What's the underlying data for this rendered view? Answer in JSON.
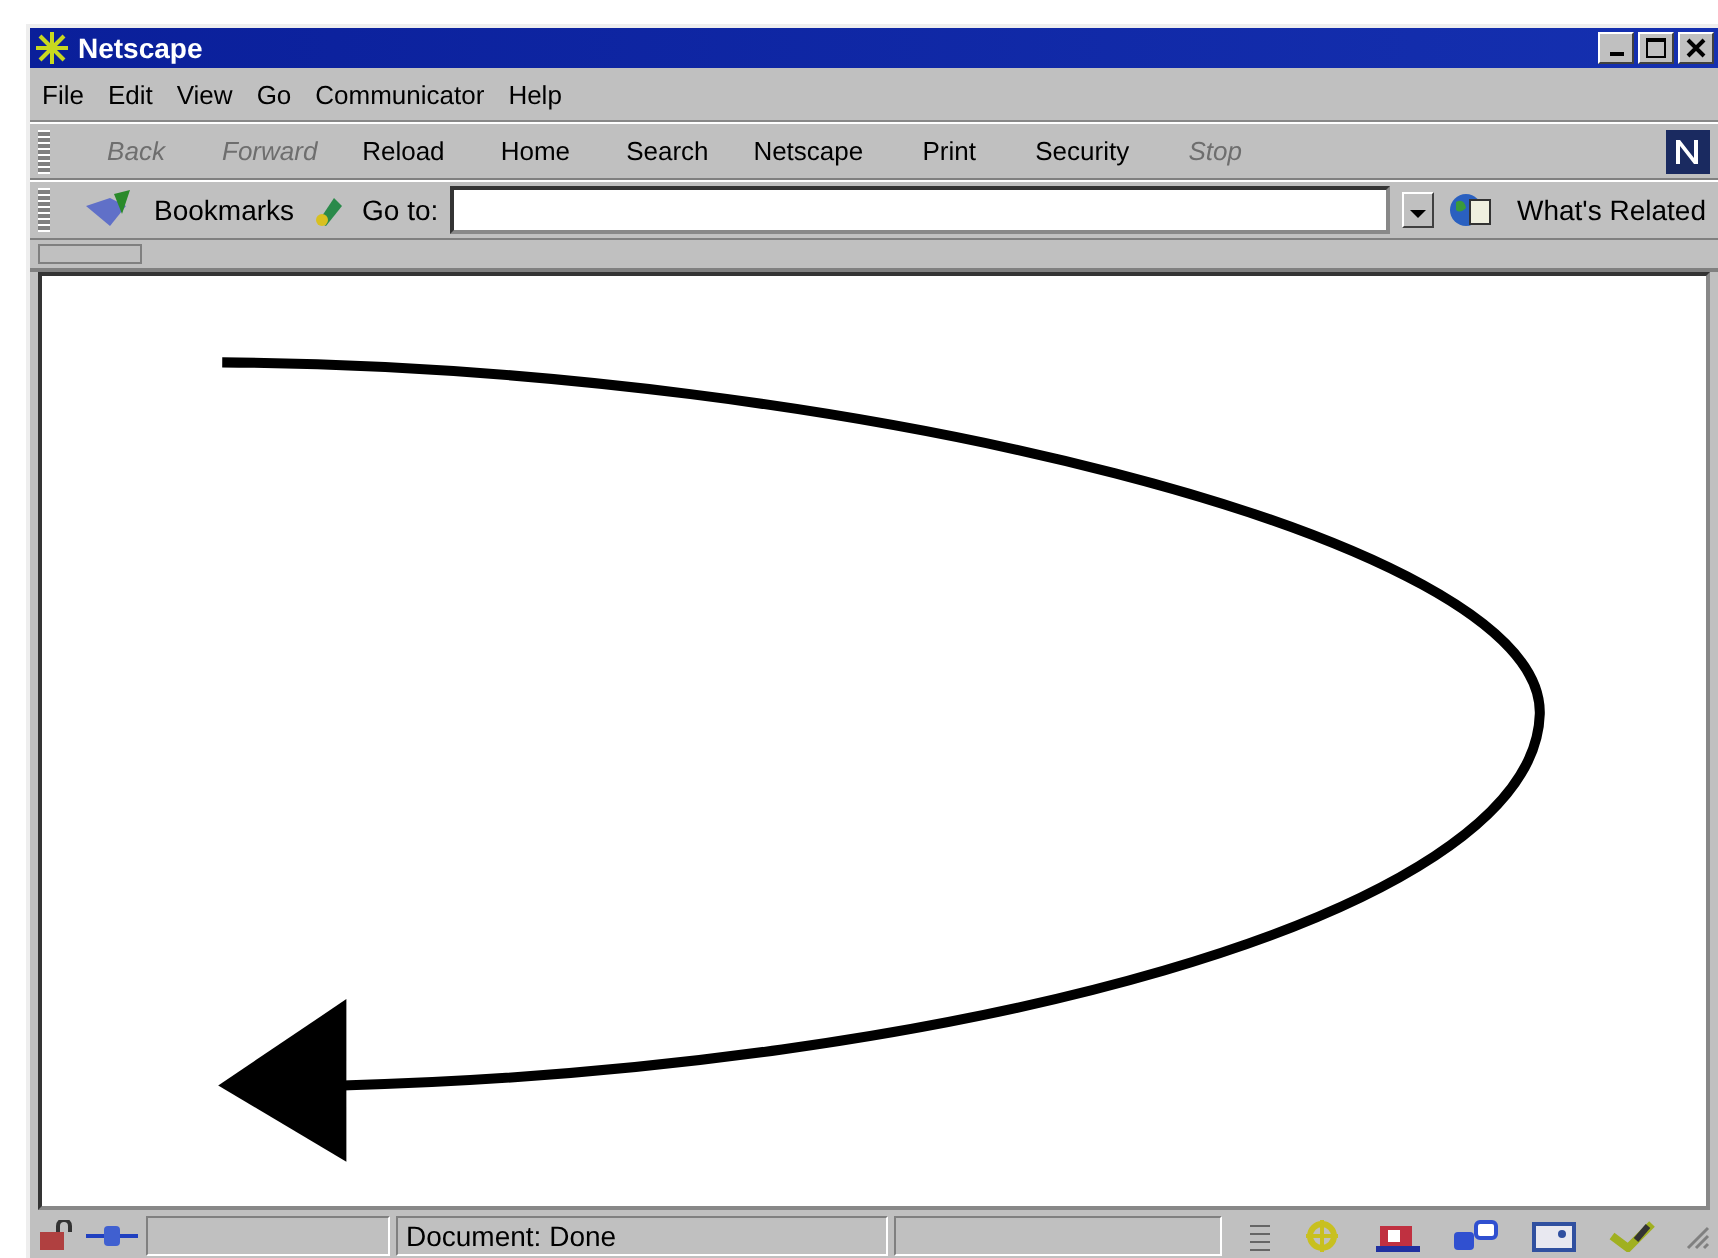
{
  "window": {
    "title": "Netscape"
  },
  "menu": [
    "File",
    "Edit",
    "View",
    "Go",
    "Communicator",
    "Help"
  ],
  "toolbar": {
    "buttons": [
      {
        "label": "Back",
        "disabled": true
      },
      {
        "label": "Forward",
        "disabled": true
      },
      {
        "label": "Reload",
        "disabled": false
      },
      {
        "label": "Home",
        "disabled": false
      },
      {
        "label": "Search",
        "disabled": false
      },
      {
        "label": "Netscape",
        "disabled": false
      },
      {
        "label": "Print",
        "disabled": false
      },
      {
        "label": "Security",
        "disabled": false
      },
      {
        "label": "Stop",
        "disabled": true
      }
    ]
  },
  "location_bar": {
    "bookmarks": "Bookmarks",
    "goto_label": "Go to:",
    "whats_related": "What's Related"
  },
  "status_bar": {
    "text": "Document: Done"
  }
}
